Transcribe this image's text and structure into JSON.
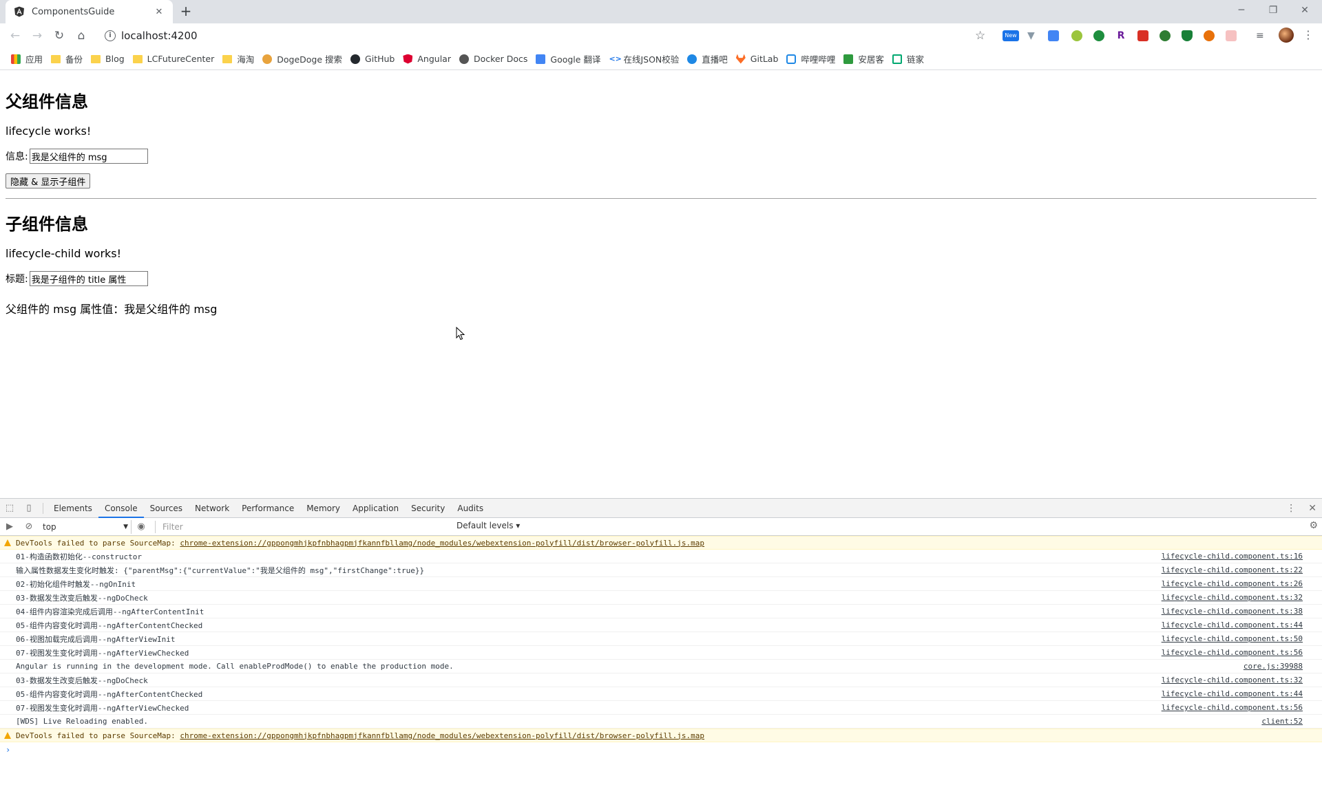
{
  "browser": {
    "tab_title": "ComponentsGuide",
    "url": "localhost:4200",
    "bookmarks": [
      {
        "label": "应用",
        "icon": "apps-grid-icon"
      },
      {
        "label": "备份",
        "icon": "folder-icon"
      },
      {
        "label": "Blog",
        "icon": "folder-icon"
      },
      {
        "label": "LCFutureCenter",
        "icon": "folder-icon"
      },
      {
        "label": "海淘",
        "icon": "folder-icon"
      },
      {
        "label": "DogeDoge 搜索",
        "icon": "dogedoge-icon"
      },
      {
        "label": "GitHub",
        "icon": "github-icon"
      },
      {
        "label": "Angular",
        "icon": "angular-icon"
      },
      {
        "label": "Docker Docs",
        "icon": "docker-icon"
      },
      {
        "label": "Google 翻译",
        "icon": "translate-icon"
      },
      {
        "label": "在线JSON校验",
        "icon": "json-icon"
      },
      {
        "label": "直播吧",
        "icon": "zhibo8-icon"
      },
      {
        "label": "GitLab",
        "icon": "gitlab-icon"
      },
      {
        "label": "哔哩哔哩",
        "icon": "bilibili-icon"
      },
      {
        "label": "安居客",
        "icon": "anjuke-icon"
      },
      {
        "label": "链家",
        "icon": "lianjia-icon"
      }
    ],
    "extensions_badge": "New"
  },
  "page": {
    "parent_heading": "父组件信息",
    "parent_works": "lifecycle works!",
    "msg_label": "信息:",
    "msg_value": "我是父组件的 msg",
    "toggle_button": "隐藏 & 显示子组件",
    "child_heading": "子组件信息",
    "child_works": "lifecycle-child works!",
    "title_label": "标题:",
    "title_value": "我是子组件的 title 属性",
    "child_msg_text": "父组件的 msg 属性值：我是父组件的 msg"
  },
  "devtools": {
    "tabs": [
      "Elements",
      "Console",
      "Sources",
      "Network",
      "Performance",
      "Memory",
      "Application",
      "Security",
      "Audits"
    ],
    "active_tab": "Console",
    "context": "top",
    "filter_placeholder": "Filter",
    "levels": "Default levels ▾",
    "console_lines": [
      {
        "type": "warn",
        "msg": "DevTools failed to parse SourceMap: ",
        "link": "chrome-extension://gppongmhjkpfnbhagpmjfkannfbllamg/node_modules/webextension-polyfill/dist/browser-polyfill.js.map",
        "src": ""
      },
      {
        "type": "log",
        "msg": "01-构造函数初始化--constructor",
        "src": "lifecycle-child.component.ts:16"
      },
      {
        "type": "log",
        "msg": "输入属性数据发生变化时触发: {\"parentMsg\":{\"currentValue\":\"我是父组件的 msg\",\"firstChange\":true}}",
        "src": "lifecycle-child.component.ts:22"
      },
      {
        "type": "log",
        "msg": "02-初始化组件时触发--ngOnInit",
        "src": "lifecycle-child.component.ts:26"
      },
      {
        "type": "log",
        "msg": "03-数据发生改变后触发--ngDoCheck",
        "src": "lifecycle-child.component.ts:32"
      },
      {
        "type": "log",
        "msg": "04-组件内容渲染完成后调用--ngAfterContentInit",
        "src": "lifecycle-child.component.ts:38"
      },
      {
        "type": "log",
        "msg": "05-组件内容变化时调用--ngAfterContentChecked",
        "src": "lifecycle-child.component.ts:44"
      },
      {
        "type": "log",
        "msg": "06-视图加载完成后调用--ngAfterViewInit",
        "src": "lifecycle-child.component.ts:50"
      },
      {
        "type": "log",
        "msg": "07-视图发生变化时调用--ngAfterViewChecked",
        "src": "lifecycle-child.component.ts:56"
      },
      {
        "type": "log",
        "msg": "Angular is running in the development mode. Call enableProdMode() to enable the production mode.",
        "src": "core.js:39988"
      },
      {
        "type": "log",
        "msg": "03-数据发生改变后触发--ngDoCheck",
        "src": "lifecycle-child.component.ts:32"
      },
      {
        "type": "log",
        "msg": "05-组件内容变化时调用--ngAfterContentChecked",
        "src": "lifecycle-child.component.ts:44"
      },
      {
        "type": "log",
        "msg": "07-视图发生变化时调用--ngAfterViewChecked",
        "src": "lifecycle-child.component.ts:56"
      },
      {
        "type": "log",
        "msg": "[WDS] Live Reloading enabled.",
        "src": "client:52"
      },
      {
        "type": "warn",
        "msg": "DevTools failed to parse SourceMap: ",
        "link": "chrome-extension://gppongmhjkpfnbhagpmjfkannfbllamg/node_modules/webextension-polyfill/dist/browser-polyfill.js.map",
        "src": ""
      }
    ],
    "prompt": "›"
  },
  "colors": {
    "accent": "#1a73e8",
    "warn_bg": "#fffbe5",
    "warn_icon": "#f2a600",
    "folder": "#fbd24c",
    "angular_red": "#dd0031"
  }
}
